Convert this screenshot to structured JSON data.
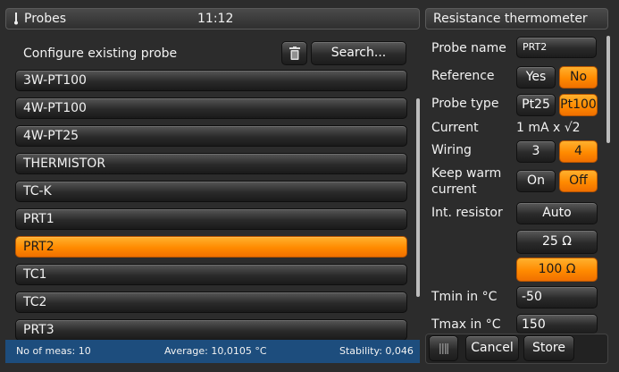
{
  "header": {
    "title": "Probes",
    "time": "11:12"
  },
  "right_panel": {
    "title": "Resistance thermometer"
  },
  "probe_list": {
    "section_label": "Configure existing probe",
    "search_label": "Search...",
    "items": [
      {
        "label": "3W-PT100",
        "selected": false
      },
      {
        "label": "4W-PT100",
        "selected": false
      },
      {
        "label": "4W-PT25",
        "selected": false
      },
      {
        "label": "THERMISTOR",
        "selected": false
      },
      {
        "label": "TC-K",
        "selected": false
      },
      {
        "label": "PRT1",
        "selected": false
      },
      {
        "label": "PRT2",
        "selected": true
      },
      {
        "label": "TC1",
        "selected": false
      },
      {
        "label": "TC2",
        "selected": false
      },
      {
        "label": "PRT3",
        "selected": false
      }
    ]
  },
  "status": {
    "meas": "No of meas: 10",
    "average": "Average: 10,0105 °C",
    "stability": "Stability: 0,046"
  },
  "properties": {
    "probe_name": {
      "label": "Probe name",
      "value": "PRT2"
    },
    "reference": {
      "label": "Reference",
      "yes": "Yes",
      "no": "No"
    },
    "probe_type": {
      "label": "Probe type",
      "opt1": "Pt25",
      "opt2": "Pt100"
    },
    "current": {
      "label": "Current",
      "value": "1 mA x √2"
    },
    "wiring": {
      "label": "Wiring",
      "opt1": "3",
      "opt2": "4"
    },
    "keep_warm": {
      "label_line1": "Keep warm",
      "label_line2": "current",
      "on": "On",
      "off": "Off"
    },
    "int_resistor": {
      "label": "Int. resistor",
      "opt1": "Auto",
      "opt2": "25 Ω",
      "opt3": "100 Ω"
    },
    "tmin": {
      "label": "Tmin in °C",
      "value": "-50"
    },
    "tmax": {
      "label": "Tmax in °C",
      "value": "150"
    }
  },
  "toolbar": {
    "cancel_label": "Cancel",
    "store_label": "Store"
  },
  "colors": {
    "accent": "#ff8a00",
    "status_bar": "#1d4d7d",
    "background": "#2c2c2c"
  }
}
